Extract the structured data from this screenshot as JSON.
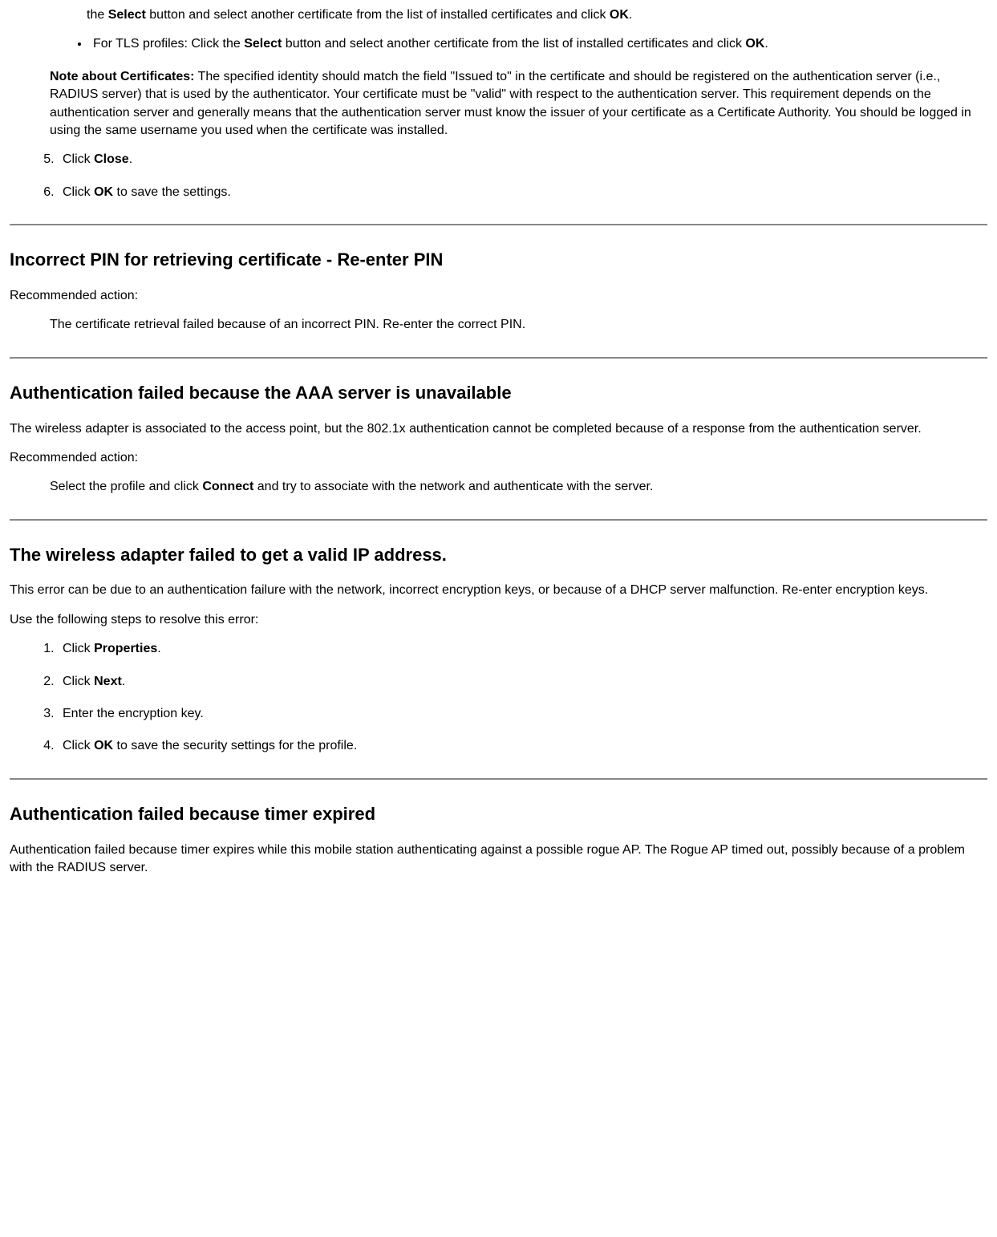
{
  "top": {
    "line1_pre": "the ",
    "line1_b1": "Select",
    "line1_mid": " button and select another certificate from the list of installed certificates and click ",
    "line1_b2": "OK",
    "line1_end": ".",
    "bullet_pre": "For TLS profiles: Click the ",
    "bullet_b1": "Select",
    "bullet_mid": " button and select another certificate from the list of installed certificates and click ",
    "bullet_b2": "OK",
    "bullet_end": ".",
    "note_b": "Note about Certificates:",
    "note_body": " The specified identity should match the field \"Issued to\" in the certificate and should be registered on the authentication server (i.e., RADIUS server) that is used by the authenticator. Your certificate must be \"valid\" with respect to the authentication server. This requirement depends on the authentication server and generally means that the authentication server must know the issuer of your certificate as a Certificate Authority. You should be logged in using the same username you used when the certificate was installed.",
    "step5_pre": "Click ",
    "step5_b": "Close",
    "step5_end": ".",
    "step6_pre": "Click ",
    "step6_b": "OK",
    "step6_end": " to save the settings."
  },
  "sec1": {
    "heading": "Incorrect PIN for retrieving certificate - Re-enter PIN",
    "rec_label": "Recommended action:",
    "rec_body": "The certificate retrieval failed because of an incorrect PIN. Re-enter the correct PIN."
  },
  "sec2": {
    "heading": "Authentication failed because the AAA server is unavailable",
    "intro": "The wireless adapter is associated to the access point, but the 802.1x authentication cannot be completed because of a response from the authentication server.",
    "rec_label": "Recommended action:",
    "rec_pre": "Select the profile and click ",
    "rec_b": "Connect",
    "rec_end": " and try to associate with the network and authenticate with the server."
  },
  "sec3": {
    "heading": "The wireless adapter failed to get a valid IP address.",
    "intro": "This error can be due to an authentication failure with the network, incorrect encryption keys, or because of a DHCP server malfunction. Re-enter encryption keys.",
    "steps_label": "Use the following steps to resolve this error:",
    "s1_pre": "Click ",
    "s1_b": "Properties",
    "s1_end": ".",
    "s2_pre": "Click ",
    "s2_b": "Next",
    "s2_end": ".",
    "s3": "Enter the encryption key.",
    "s4_pre": "Click ",
    "s4_b": "OK",
    "s4_end": " to save the security settings for the profile."
  },
  "sec4": {
    "heading": "Authentication failed because timer expired",
    "body": "Authentication failed because timer expires while this mobile station authenticating against a possible rogue AP. The Rogue AP timed out, possibly because of a problem with the RADIUS server."
  }
}
